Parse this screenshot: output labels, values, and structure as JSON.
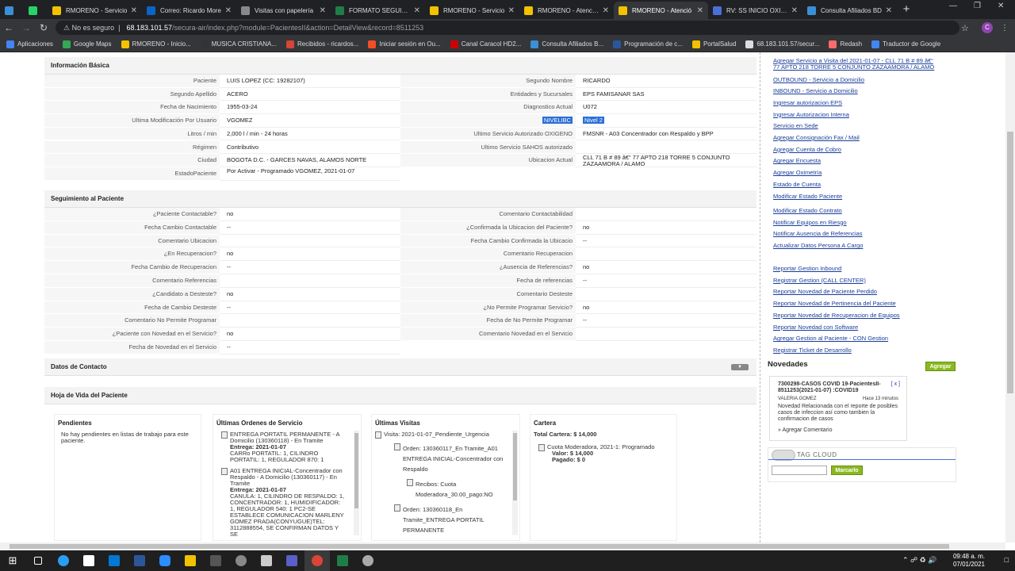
{
  "browser": {
    "tabs": [
      {
        "title": "",
        "color": "#3b8fd8",
        "kind": "tiny"
      },
      {
        "title": "",
        "color": "#25d366",
        "kind": "tiny"
      },
      {
        "title": "RMORENO - Servicio",
        "color": "#f2c200"
      },
      {
        "title": "Correo: Ricardo More",
        "color": "#0a64c8"
      },
      {
        "title": "Visitas con papelería",
        "color": "#888888"
      },
      {
        "title": "FORMATO SEGUIMIE",
        "color": "#1e7e45"
      },
      {
        "title": "RMORENO - Servicio",
        "color": "#f2c200"
      },
      {
        "title": "RMORENO - Atención",
        "color": "#f2c200"
      },
      {
        "title": "RMORENO - Atenció",
        "color": "#f2c200",
        "active": true
      },
      {
        "title": "RV: SS INICIO OXIGE",
        "color": "#4a6fd8"
      },
      {
        "title": "Consulta Afiliados BD",
        "color": "#3b8fd8"
      }
    ],
    "url_insecure": "No es seguro",
    "url_host": "68.183.101.57",
    "url_path": "/secura-air/index.php?module=PacientesII&action=DetailView&record=8511253",
    "bookmarks": [
      {
        "label": "Aplicaciones",
        "color": "#4285f4"
      },
      {
        "label": "Google Maps",
        "color": "#34a853"
      },
      {
        "label": "RMORENO - Inicio...",
        "color": "#f2c200"
      },
      {
        "label": "MUSICA CRISTIANA...",
        "color": "#333333"
      },
      {
        "label": "Recibidos - ricardos...",
        "color": "#d44638"
      },
      {
        "label": "Iniciar sesión en Ou...",
        "color": "#f25022"
      },
      {
        "label": "Canal Caracol HD2...",
        "color": "#d00000"
      },
      {
        "label": "Consulta Afiliados B...",
        "color": "#3b8fd8"
      },
      {
        "label": "Programación de c...",
        "color": "#2b579a"
      },
      {
        "label": "PortalSalud",
        "color": "#f2c200"
      },
      {
        "label": "68.183.101.57/secur...",
        "color": "#dddddd"
      },
      {
        "label": "Redash",
        "color": "#ff6b6b"
      },
      {
        "label": "Traductor de Google",
        "color": "#4285f4"
      }
    ]
  },
  "info_basica": {
    "title": "Información Básica",
    "left": [
      {
        "label": "Paciente",
        "value": "LUIS LOPEZ (CC: 19282107)"
      },
      {
        "label": "Segundo Apellido",
        "value": "ACERO"
      },
      {
        "label": "Fecha de Nacimiento",
        "value": "1955-03-24"
      },
      {
        "label": "Ultima Modificación Por Usuario",
        "value": "VGOMEZ"
      },
      {
        "label": "Litros / min",
        "value": "2,000 l / min - 24 horas"
      },
      {
        "label": "Régimen",
        "value": "Contributivo"
      },
      {
        "label": "Ciudad",
        "value": "BOGOTA D.C. - GARCES NAVAS, ALAMOS NORTE"
      },
      {
        "label": "EstadoPaciente",
        "value": "Por Activar - Programado VGOMEZ, 2021-01-07"
      }
    ],
    "right": [
      {
        "label": "Segundo Nombre",
        "value": "RICARDO"
      },
      {
        "label": "Entidades y Sucursales",
        "value": "EPS FAMISANAR SAS"
      },
      {
        "label": "Diagnostico Actual",
        "value": "U072"
      },
      {
        "label": "NIVELIBC",
        "value": "Nivel 2"
      },
      {
        "label": "Ultimo Servicio Autorizado OXIGENO",
        "value": "FMSNR - A03 Concentrador con Respaldo y BPP"
      },
      {
        "label": "Ultimo Servicio SAHOS autorizado",
        "value": ""
      },
      {
        "label": "Ubicacion Actual",
        "value": "CLL 71 B # 89 â€“ 77 APTO 218 TORRE 5 CONJUNTO ZAZAAMORA / ALAMO"
      }
    ]
  },
  "seguimiento": {
    "title": "Seguimiento al Paciente",
    "left": [
      {
        "label": "¿Paciente Contactable?",
        "value": "no"
      },
      {
        "label": "Fecha Cambio Contactable",
        "value": "--"
      },
      {
        "label": "Comentario Ubicacion",
        "value": ""
      },
      {
        "label": "¿En Recuperacion?",
        "value": "no"
      },
      {
        "label": "Fecha Cambio de Recuperacion",
        "value": "--"
      },
      {
        "label": "Comentario Referencias",
        "value": ""
      },
      {
        "label": "¿Candidato a Desteste?",
        "value": "no"
      },
      {
        "label": "Fecha de Cambio Desteste",
        "value": "--"
      },
      {
        "label": "Comentario No Permite Programar",
        "value": ""
      },
      {
        "label": "¿Paciente con Novedad en el Servicio?",
        "value": "no"
      },
      {
        "label": "Fecha de Novedad en el Servicio",
        "value": "--"
      }
    ],
    "right": [
      {
        "label": "Comentario Contactabilidad",
        "value": ""
      },
      {
        "label": "¿Confirmada la Ubicacion del Paciente?",
        "value": "no"
      },
      {
        "label": "Fecha Cambio Confirmada la Ubicacio",
        "value": "--"
      },
      {
        "label": "Comentario Recuperacion",
        "value": ""
      },
      {
        "label": "¿Ausencia de Referencias?",
        "value": "no"
      },
      {
        "label": "Fecha de referencias",
        "value": "--"
      },
      {
        "label": "Comentario Desteste",
        "value": ""
      },
      {
        "label": "¿No Permite Programar Servicio?",
        "value": "no"
      },
      {
        "label": "Fecha de No Permite Programar",
        "value": "--"
      },
      {
        "label": "Comentario Novedad en el Servicio",
        "value": ""
      }
    ]
  },
  "datos_contacto": {
    "title": "Datos de Contacto"
  },
  "hoja_vida": {
    "title": "Hoja de Vida del Paciente",
    "pendientes": {
      "title": "Pendientes",
      "text": "No hay pendientes en listas de trabajo para este paciente."
    },
    "ordenes": {
      "title": "Últimas Ordenes de Servicio",
      "items": [
        {
          "head": "ENTREGA PORTATIL PERMANENTE - A Domicilio (130360118) - En Tramite",
          "entrega": "Entrega: 2021-01-07",
          "detail": "CARRo PORTATIL: 1, CILINDRO PORTATIL: 1, REGULADOR 870: 1"
        },
        {
          "head": "A01 ENTREGA INICIAL-Concentrador con Respaldo - A Domicilio (130360117) - En Tramite",
          "entrega": "Entrega: 2021-01-07",
          "detail": "CANULA: 1, CILINDRO DE RESPALDO: 1, CONCENTRADOR: 1, HUMIDIFICADOR: 1, REGULADOR 540: 1 PC2-SE ESTABLECE COMUNICACION MARLENY GOMEZ PRADA(CONYUGUE)TEL: 3112888554, SE CONFIRMAN DATOS Y SE"
        }
      ]
    },
    "visitas": {
      "title": "Últimas Visitas",
      "visita": "Visita: 2021-01-07_Pendiente_Urgencia",
      "orden1": "Orden: 130360117_En Tramite_A01 ENTREGA INICIAL-Concentrador con Respaldo",
      "recibos": "Recibos: Cuota Moderadora_30.00_pago:NO",
      "orden2": "Orden: 130360118_En Tramite_ENTREGA PORTATIL PERMANENTE"
    },
    "cartera": {
      "title": "Cartera",
      "total": "Total Cartera: $ 14,000",
      "cuota": "Cuota Moderadora, 2021-1: Programado",
      "valor": "Valor: $ 14,000",
      "pagado": "Pagado: $ 0"
    }
  },
  "sidebar": {
    "links_a": [
      "Agregar Servicio a Visita del 2021-01-07 - CLL 71 B # 89 â€“ 77 APTO 218 TORRE 5 CONJUNTO ZAZAAMORA / ALAMO",
      "OUTBOUND - Servicio a Domicilio",
      "INBOUND - Servicio a Domicilio",
      "Ingresar autorizacion EPS",
      "Ingresar Autorizacion Interna",
      "Servicio en Sede",
      "Agregar Consignación Fax / Mail",
      "Agregar Cuenta de Cobro",
      "Agregar Encuesta",
      "Agregar Oximetría",
      "Estado de Cuenta",
      "Modificar Estado Paciente"
    ],
    "links_b": [
      "Modificar Estado Contrato",
      "Notificar Equipos en Riesgo",
      "Notificar Ausencia de Referencias",
      "Actualizar Datos Persona A Cargo"
    ],
    "links_c": [
      "Reportar Gestion Inbound",
      "Registrar Gestion (CALL CENTER)",
      "Reportar Novedad de Paciente Perdido",
      "Reportar Novedad de Pertinencia del Paciente",
      "Reportar Novedad de Recuperacion de Equipos",
      "Reportar Novedad con Software",
      "Agregar Gestion al Paciente - CON Gestion",
      "Registrar Ticket de Desarrollo"
    ],
    "novedades_title": "Novedades",
    "agregar_label": "Agregar",
    "novedad": {
      "title": "7300298-CASOS COVID 19-PacientesII-8511253(2021-01-07) :COVID19",
      "close": "[ x ]",
      "user": "VALERIA.GOMEZ",
      "time": "Hace 13 minutos",
      "body": "Novedad Relacionada con el reporte de posibles casos de infeccion así como tambien la confirmacion de casos",
      "comment": "» Agregar Comentario"
    },
    "tagcloud_title": "TAG CLOUD",
    "marcar_label": "Marcarlo"
  },
  "taskbar": {
    "time": "09:48 a. m.",
    "date": "07/01/2021"
  }
}
